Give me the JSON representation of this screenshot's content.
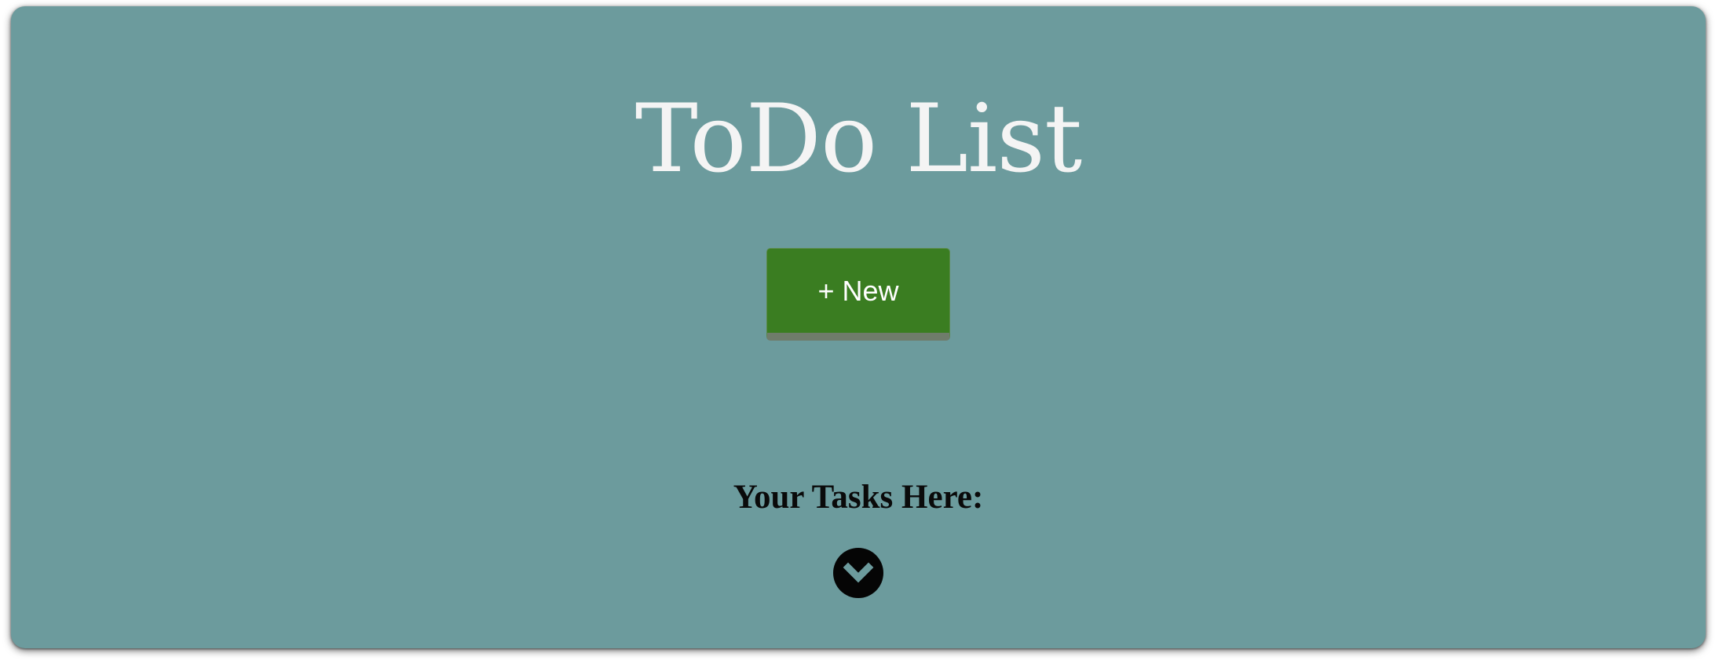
{
  "header": {
    "title": "ToDo List"
  },
  "actions": {
    "new_label": "+ New"
  },
  "tasks": {
    "heading": "Your Tasks Here:",
    "expand_icon": "chevron-down-icon"
  },
  "colors": {
    "background": "#6c9b9d",
    "new_button": "#3a7d21",
    "title_text": "#f4f4f4"
  }
}
